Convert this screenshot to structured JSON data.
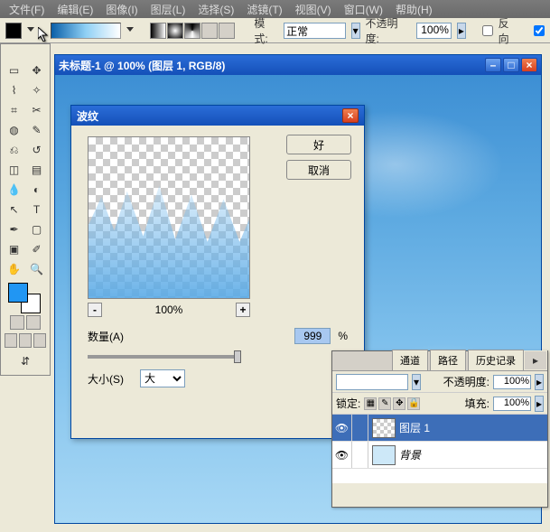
{
  "menu": {
    "file": "文件(F)",
    "edit": "编辑(E)",
    "image": "图像(I)",
    "layer": "图层(L)",
    "select": "选择(S)",
    "filter": "滤镜(T)",
    "view": "视图(V)",
    "window": "窗口(W)",
    "help": "帮助(H)"
  },
  "options": {
    "mode_label": "模式:",
    "mode_value": "正常",
    "opacity_label": "不透明度:",
    "opacity_value": "100%",
    "reverse": "反向"
  },
  "doc": {
    "title": "未标题-1 @ 100% (图层 1, RGB/8)"
  },
  "dialog": {
    "title": "波纹",
    "ok": "好",
    "cancel": "取消",
    "zoom": "100%",
    "minus": "-",
    "plus": "+",
    "amount_label": "数量(A)",
    "amount_value": "999",
    "amount_pct": "%",
    "size_label": "大小(S)",
    "size_value": "大"
  },
  "layers": {
    "tabs": {
      "channels": "通道",
      "paths": "路径",
      "history": "历史记录"
    },
    "opacity_label": "不透明度:",
    "opacity_value": "100%",
    "lock_label": "锁定:",
    "fill_label": "填充:",
    "fill_value": "100%",
    "layer1": "图层 1",
    "bg": "背景"
  },
  "winbtn": {
    "min": "–",
    "max": "□",
    "close": "×"
  }
}
